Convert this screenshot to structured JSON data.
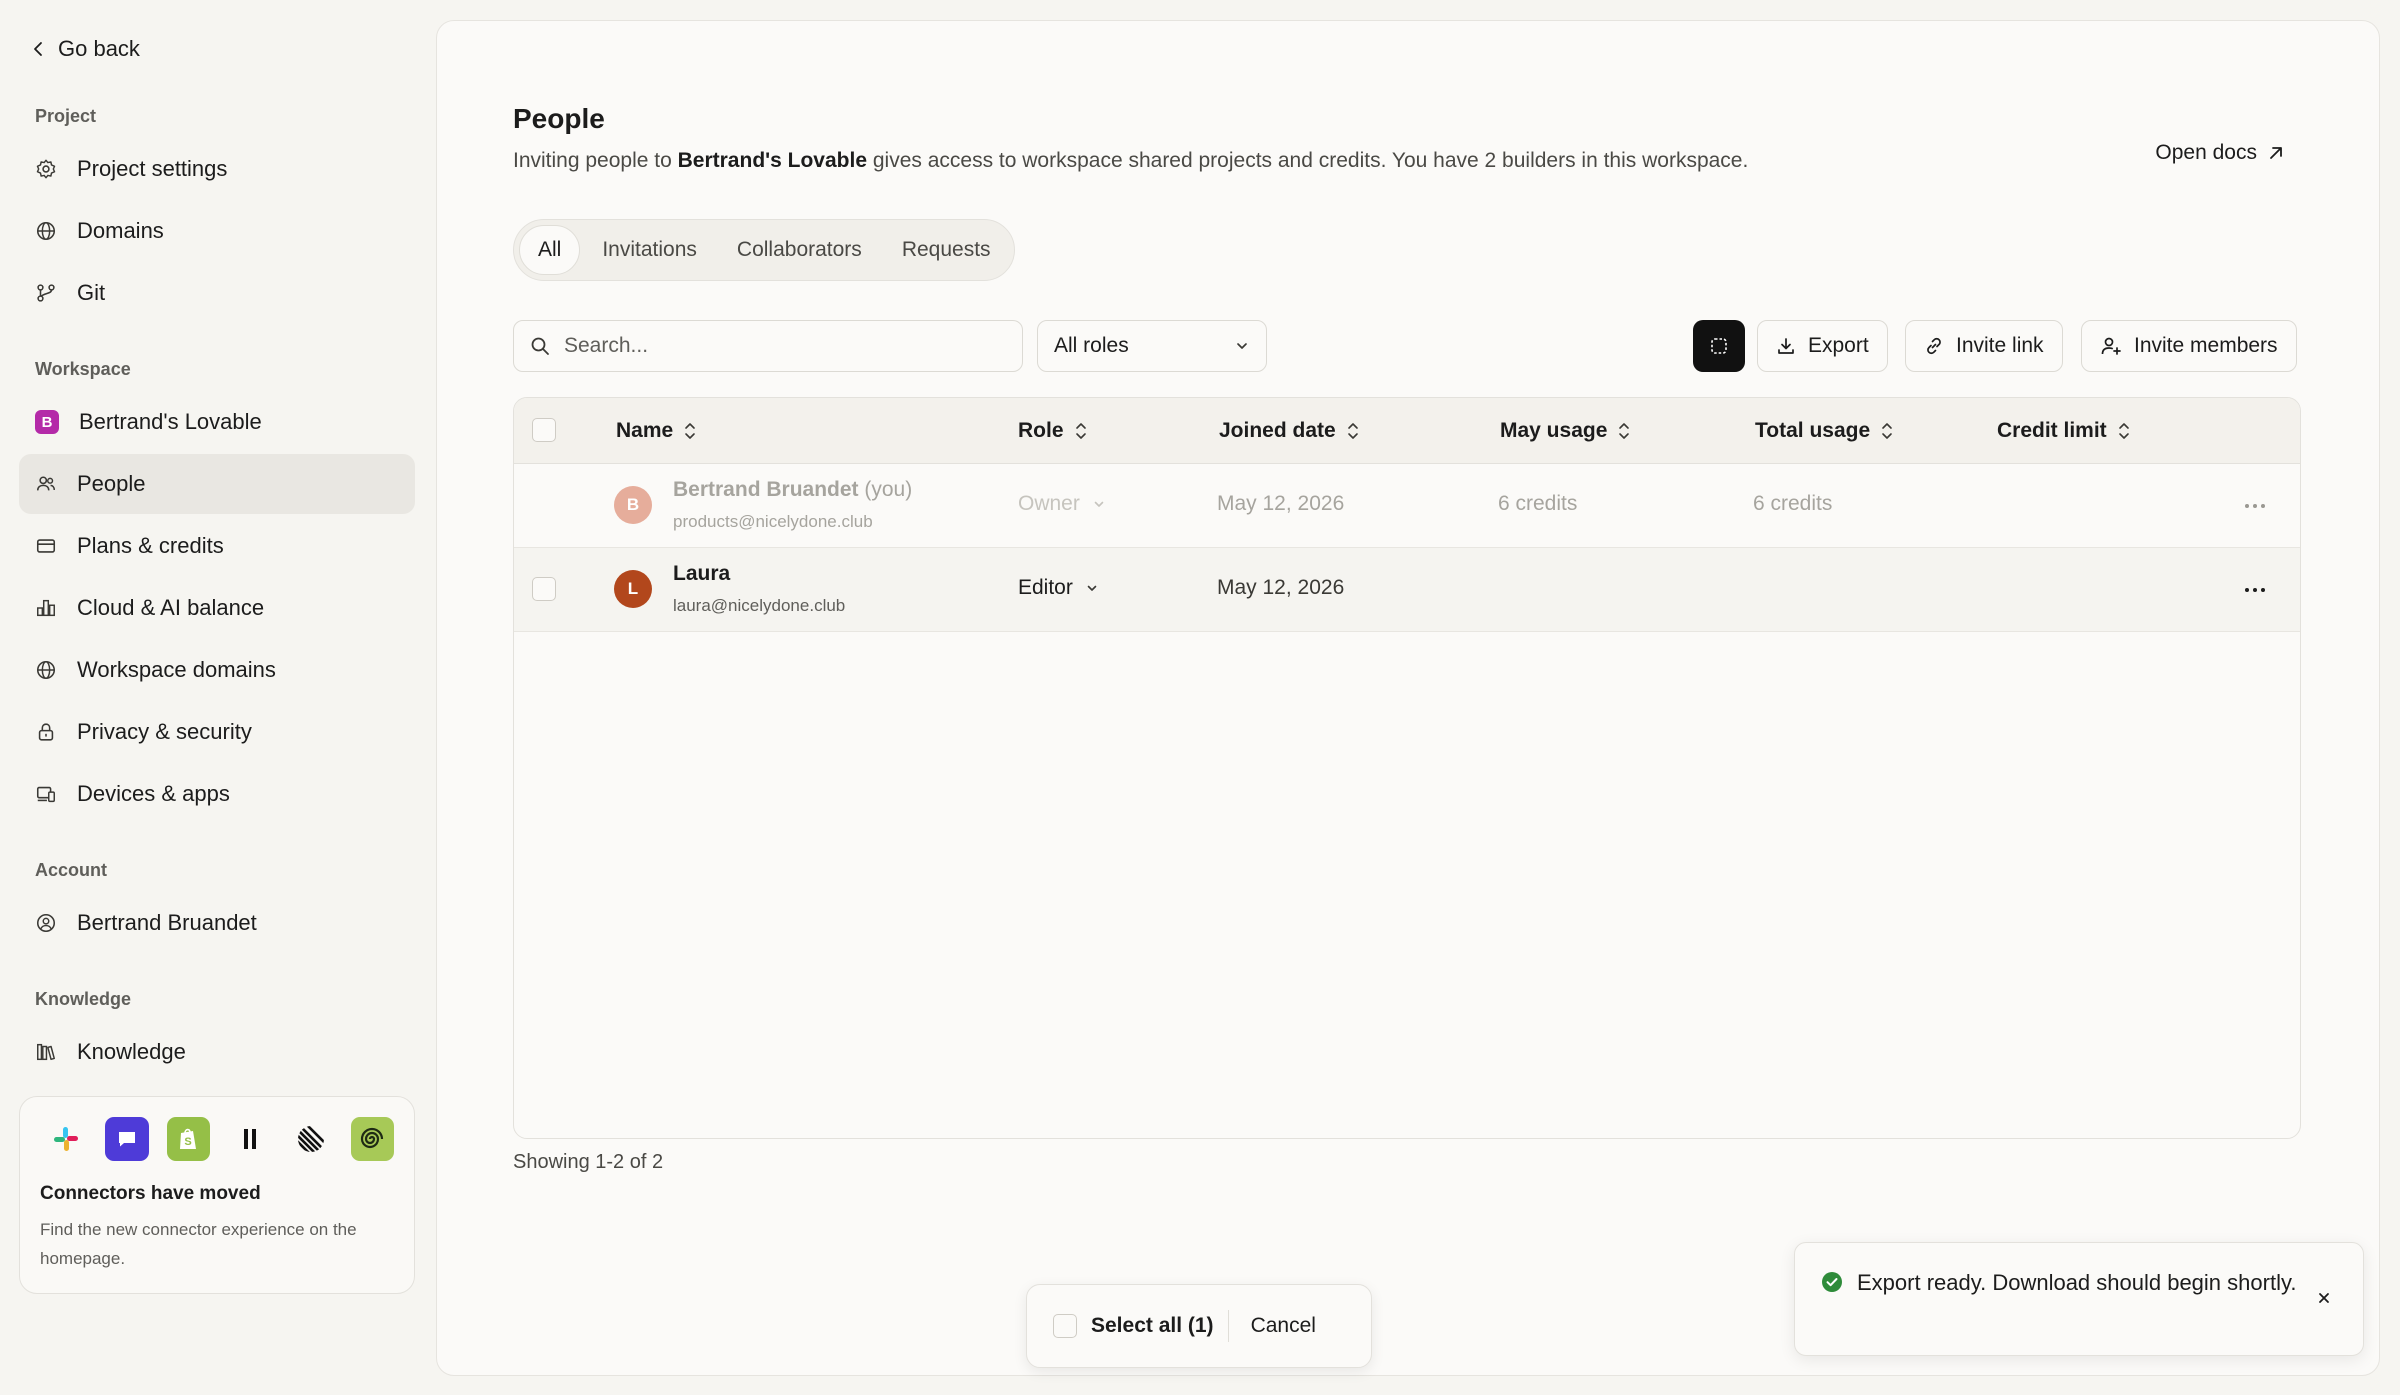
{
  "sidebar": {
    "back_label": "Go back",
    "project": {
      "label": "Project",
      "items": [
        {
          "label": "Project settings",
          "icon": "gear-icon"
        },
        {
          "label": "Domains",
          "icon": "globe-icon"
        },
        {
          "label": "Git",
          "icon": "git-icon"
        }
      ]
    },
    "workspace": {
      "label": "Workspace",
      "badge": "B",
      "badge_color": "#b42aa8",
      "items": [
        {
          "label": "Bertrand's Lovable",
          "icon": "workspace-badge"
        },
        {
          "label": "People",
          "icon": "users-icon",
          "active": true
        },
        {
          "label": "Plans & credits",
          "icon": "credit-card-icon"
        },
        {
          "label": "Cloud & AI balance",
          "icon": "bar-chart-icon"
        },
        {
          "label": "Workspace domains",
          "icon": "globe-icon"
        },
        {
          "label": "Privacy & security",
          "icon": "lock-icon"
        },
        {
          "label": "Devices & apps",
          "icon": "devices-icon"
        }
      ]
    },
    "account": {
      "label": "Account",
      "items": [
        {
          "label": "Bertrand Bruandet",
          "icon": "user-circle-icon"
        }
      ]
    },
    "knowledge": {
      "label": "Knowledge",
      "items": [
        {
          "label": "Knowledge",
          "icon": "library-icon"
        }
      ]
    },
    "connectors": {
      "title": "Connectors have moved",
      "desc": "Find the new connector experience on the homepage.",
      "icons": [
        "slack-icon",
        "chat-app-icon",
        "shopify-icon",
        "linear-pause-icon",
        "stripe-lines-icon",
        "spiral-app-icon"
      ]
    }
  },
  "main": {
    "title": "People",
    "desc_prefix": "Inviting people to ",
    "desc_bold": "Bertrand's Lovable",
    "desc_suffix": " gives access to workspace shared projects and credits. You have 2 builders in this workspace.",
    "open_docs": "Open docs",
    "tabs": [
      {
        "label": "All",
        "active": true
      },
      {
        "label": "Invitations"
      },
      {
        "label": "Collaborators"
      },
      {
        "label": "Requests"
      }
    ],
    "search_placeholder": "Search...",
    "roles_filter": "All roles",
    "toolbar": {
      "export": "Export",
      "invite_link": "Invite link",
      "invite_members": "Invite members"
    },
    "table": {
      "columns": [
        "Name",
        "Role",
        "Joined date",
        "May usage",
        "Total usage",
        "Credit limit"
      ],
      "rows": [
        {
          "initial": "B",
          "avatar_color": "#e6ad9b",
          "name": "Bertrand Bruandet",
          "you": "(you)",
          "email": "products@nicelydone.club",
          "role": "Owner",
          "joined": "May 12, 2026",
          "may_usage": "6 credits",
          "total_usage": "6 credits",
          "credit_limit": ""
        },
        {
          "initial": "L",
          "avatar_color": "#b2471c",
          "name": "Laura",
          "email": "laura@nicelydone.club",
          "role": "Editor",
          "joined": "May 12, 2026",
          "may_usage": "",
          "total_usage": "",
          "credit_limit": ""
        }
      ]
    },
    "showing": "Showing 1-2 of 2"
  },
  "bulk": {
    "select_all": "Select all (1)",
    "cancel": "Cancel"
  },
  "toast": {
    "message": "Export ready. Download should begin shortly.",
    "status_color": "#2e8b3a"
  }
}
